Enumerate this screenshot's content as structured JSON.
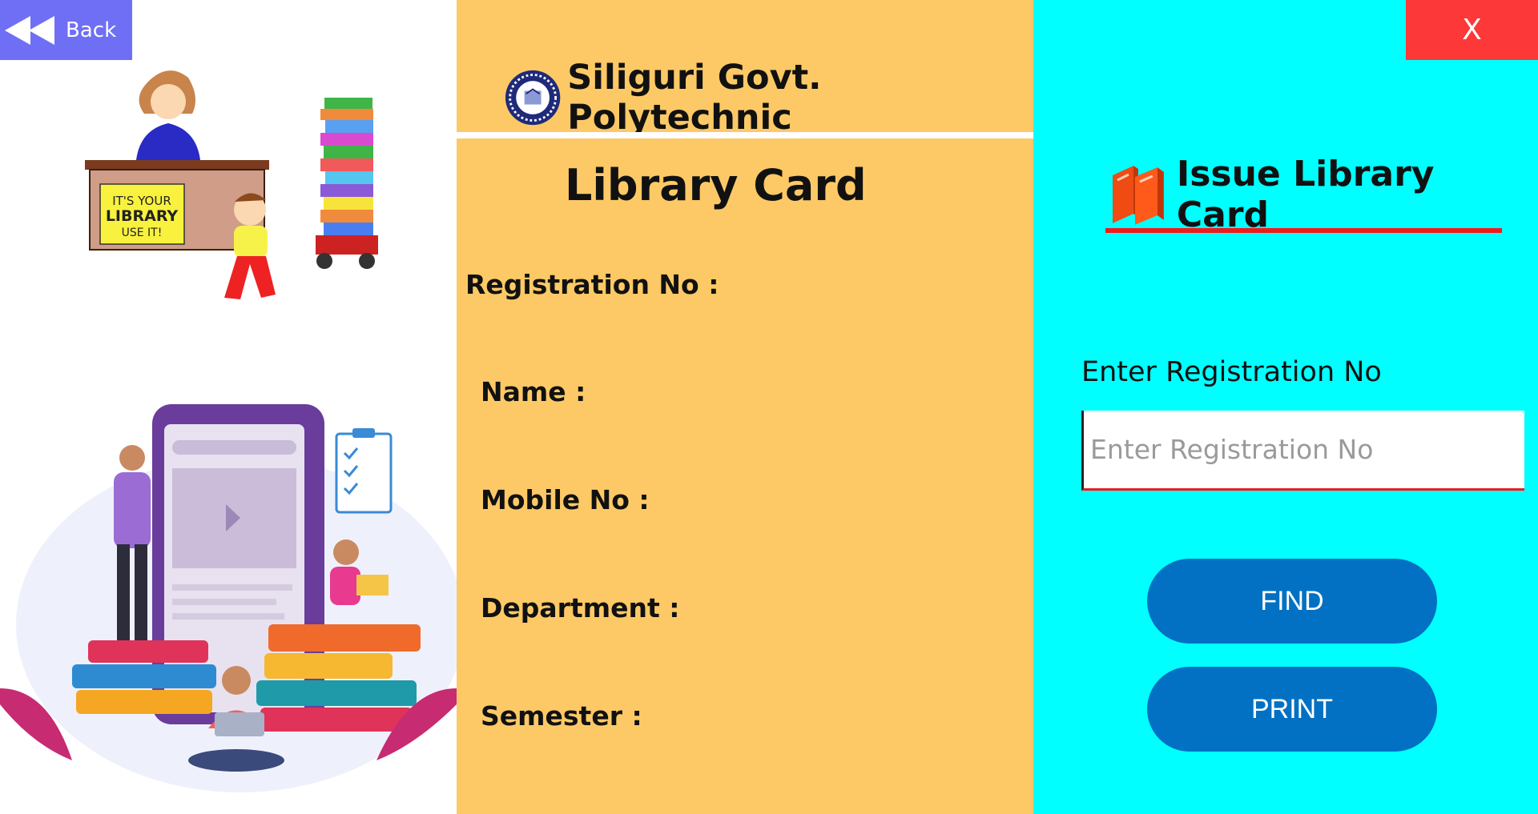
{
  "nav": {
    "back_label": "Back",
    "close_label": "X"
  },
  "college": {
    "name": "Siliguri Govt. Polytechnic"
  },
  "card": {
    "title": "Library Card",
    "fields": {
      "registration": "Registration No :",
      "name": "Name :",
      "mobile": "Mobile No :",
      "department": "Department :",
      "semester": "Semester :"
    }
  },
  "issue": {
    "title": "Issue Library Card",
    "reg_label": "Enter Registration No",
    "reg_placeholder": "Enter Registration No",
    "reg_value": "",
    "find_label": "FIND",
    "print_label": "PRINT"
  },
  "illustrations": {
    "top": "library-desk-illustration",
    "sign_text": "IT'S YOUR LIBRARY USE IT!",
    "bottom": "online-library-illustration"
  },
  "colors": {
    "back": "#6f6ff5",
    "close": "#fc3838",
    "middle_bg": "#fdc966",
    "right_bg": "#00ffff",
    "accent_red": "#f21a1a",
    "button_blue": "#0271c3"
  }
}
